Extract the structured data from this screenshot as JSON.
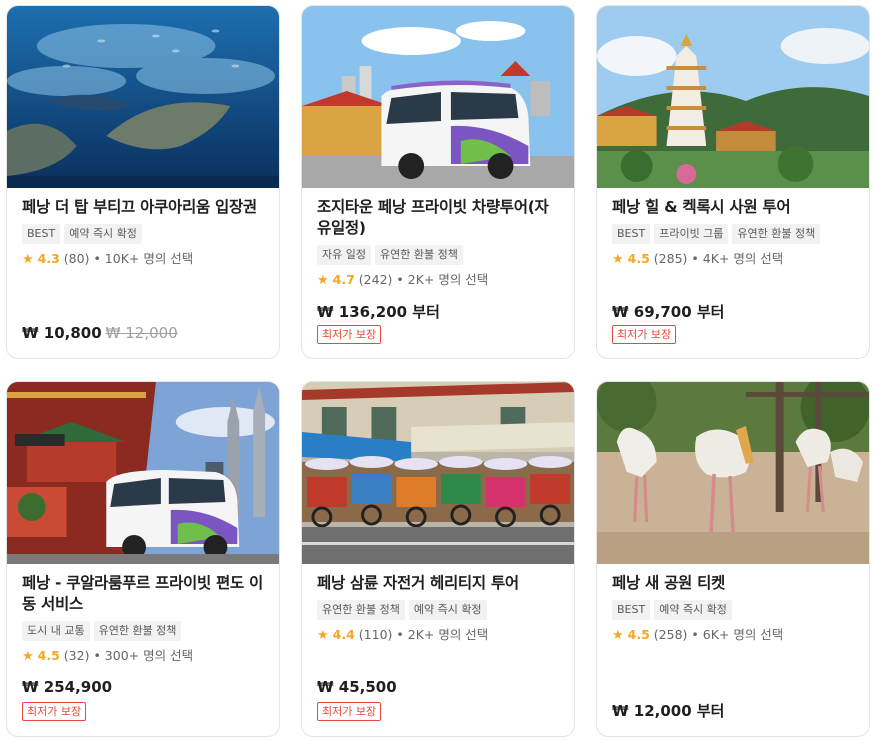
{
  "colors": {
    "star": "#f5a623",
    "badge": "#e8473b",
    "tag_bg": "#f2f2f2"
  },
  "cards": [
    {
      "title": "페낭 더 탑 부티끄 아쿠아리움 입장권",
      "tags": [
        "BEST",
        "예약 즉시 확정"
      ],
      "star": "★",
      "rating": "4.3",
      "reviews": "(80)",
      "popularity": "• 10K+ 명의 선택",
      "price": "₩ 10,800",
      "original_price": "₩ 12,000",
      "badge": "",
      "image": "aquarium-fish-photo"
    },
    {
      "title": "조지타운 페낭 프라이빗 차량투어(자유일정)",
      "tags": [
        "자유 일정",
        "유연한 환불 정책"
      ],
      "star": "★",
      "rating": "4.7",
      "reviews": "(242)",
      "popularity": "• 2K+ 명의 선택",
      "price": "₩ 136,200 부터",
      "original_price": "",
      "badge": "최저가 보장",
      "image": "private-van-photo"
    },
    {
      "title": "페낭 힐 & 켁록시 사원 투어",
      "tags": [
        "BEST",
        "프라이빗 그룹",
        "유연한 환불 정책"
      ],
      "star": "★",
      "rating": "4.5",
      "reviews": "(285)",
      "popularity": "• 4K+ 명의 선택",
      "price": "₩ 69,700 부터",
      "original_price": "",
      "badge": "최저가 보장",
      "image": "temple-pagoda-photo"
    },
    {
      "title": "페낭 - 쿠알라룸푸르 프라이빗 편도 이동 서비스",
      "tags": [
        "도시 내 교통",
        "유연한 환불 정책"
      ],
      "star": "★",
      "rating": "4.5",
      "reviews": "(32)",
      "popularity": "• 300+ 명의 선택",
      "price": "₩ 254,900",
      "original_price": "",
      "badge": "최저가 보장",
      "image": "van-city-towers-photo"
    },
    {
      "title": "페낭 삼륜 자전거 헤리티지 투어",
      "tags": [
        "유연한 환불 정책",
        "예약 즉시 확정"
      ],
      "star": "★",
      "rating": "4.4",
      "reviews": "(110)",
      "popularity": "• 2K+ 명의 선택",
      "price": "₩ 45,500",
      "original_price": "",
      "badge": "최저가 보장",
      "image": "trishaw-street-photo"
    },
    {
      "title": "페낭 새 공원 티켓",
      "tags": [
        "BEST",
        "예약 즉시 확정"
      ],
      "star": "★",
      "rating": "4.5",
      "reviews": "(258)",
      "popularity": "• 6K+ 명의 선택",
      "price": "₩ 12,000 부터",
      "original_price": "",
      "badge": "",
      "image": "storks-bird-park-photo"
    }
  ]
}
